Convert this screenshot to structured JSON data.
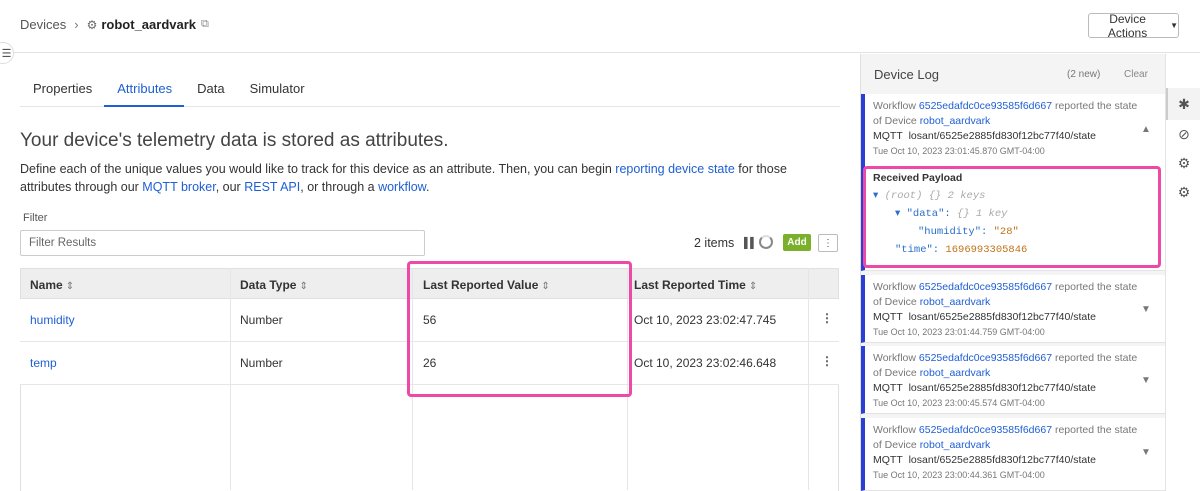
{
  "breadcrumb": {
    "root": "Devices",
    "sep": "›",
    "device": "robot_aardvark"
  },
  "device_actions": "Device Actions",
  "tabs": [
    {
      "label": "Properties"
    },
    {
      "label": "Attributes"
    },
    {
      "label": "Data"
    },
    {
      "label": "Simulator"
    }
  ],
  "heading": "Your device's telemetry data is stored as attributes.",
  "description": {
    "p1": "Define each of the unique values you would like to track for this device as an attribute. Then, you can begin ",
    "link1": "reporting device state",
    "p2": " for those attributes through our ",
    "link2": "MQTT broker",
    "p3": ", our ",
    "link3": "REST API",
    "p4": ", or through a ",
    "link4": "workflow",
    "p5": "."
  },
  "filter": {
    "label": "Filter",
    "placeholder": "Filter Results"
  },
  "items_count": "2 items",
  "add_label": "Add",
  "table": {
    "headers": [
      "Name",
      "Data Type",
      "Last Reported Value",
      "Last Reported Time"
    ],
    "rows": [
      {
        "name": "humidity",
        "type": "Number",
        "value": "56",
        "time": "Oct 10, 2023 23:02:47.745"
      },
      {
        "name": "temp",
        "type": "Number",
        "value": "26",
        "time": "Oct 10, 2023 23:02:46.648"
      }
    ]
  },
  "log": {
    "title": "Device Log",
    "new_count": "(2 new)",
    "clear": "Clear",
    "entries": [
      {
        "wf_prefix": "Workflow ",
        "workflow": "6525edafdc0ce93585f6d667",
        "wf_suffix": " reported the state",
        "dev_prefix": "of Device ",
        "device": "robot_aardvark",
        "mqtt_label": "MQTT",
        "topic": "losant/6525e2885fd830f12bc77f40/state",
        "time": "Tue Oct 10, 2023 23:01:45.870 GMT-04:00"
      },
      {
        "wf_prefix": "Workflow ",
        "workflow": "6525edafdc0ce93585f6d667",
        "wf_suffix": " reported the state",
        "dev_prefix": "of Device ",
        "device": "robot_aardvark",
        "mqtt_label": "MQTT",
        "topic": "losant/6525e2885fd830f12bc77f40/state",
        "time": "Tue Oct 10, 2023 23:01:44.759 GMT-04:00"
      },
      {
        "wf_prefix": "Workflow ",
        "workflow": "6525edafdc0ce93585f6d667",
        "wf_suffix": " reported the state",
        "dev_prefix": "of Device ",
        "device": "robot_aardvark",
        "mqtt_label": "MQTT",
        "topic": "losant/6525e2885fd830f12bc77f40/state",
        "time": "Tue Oct 10, 2023 23:00:45.574 GMT-04:00"
      },
      {
        "wf_prefix": "Workflow ",
        "workflow": "6525edafdc0ce93585f6d667",
        "wf_suffix": " reported the state",
        "dev_prefix": "of Device ",
        "device": "robot_aardvark",
        "mqtt_label": "MQTT",
        "topic": "losant/6525e2885fd830f12bc77f40/state",
        "time": "Tue Oct 10, 2023 23:00:44.361 GMT-04:00"
      }
    ],
    "payload": {
      "label": "Received Payload",
      "root": "(root)",
      "root_meta": "{} 2 keys",
      "data_key": "\"data\":",
      "data_meta": "{} 1 key",
      "humidity_key": "\"humidity\":",
      "humidity_val": "\"28\"",
      "time_key": "\"time\":",
      "time_val": "1696993305846"
    }
  },
  "colors": {
    "link": "#1e5fd4",
    "highlight": "#ec4aa6",
    "add_button": "#7ab02a",
    "log_bar": "#2a3fd6"
  }
}
